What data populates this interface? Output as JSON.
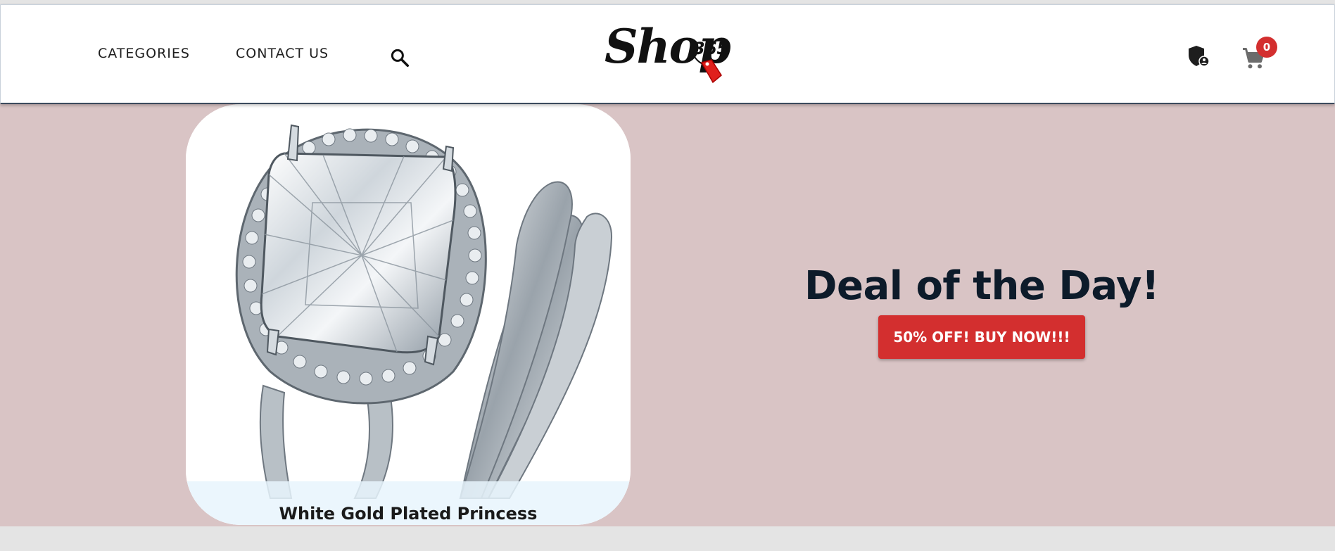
{
  "nav": {
    "categories_label": "CATEGORIES",
    "contact_label": "CONTACT US",
    "search_icon": "search-icon"
  },
  "logo": {
    "text": "Shop",
    "number": "365"
  },
  "actions": {
    "admin_icon": "admin-shield-icon",
    "cart_icon": "cart-icon",
    "cart_count": "0"
  },
  "hero": {
    "product_name": "White Gold Plated Princess",
    "deal_title": "Deal of the Day!",
    "deal_button_label": "50% OFF! BUY NOW!!!"
  },
  "colors": {
    "hero_background": "#d9c4c5",
    "accent_red": "#d32f2f",
    "title_dark": "#0d1b2a"
  }
}
